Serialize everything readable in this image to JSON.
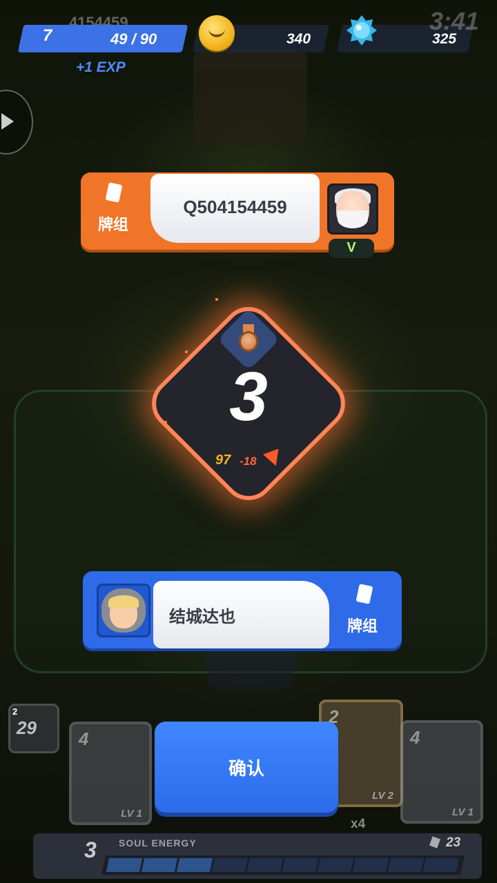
{
  "hud": {
    "ghost_name": "4154459",
    "level": "7",
    "xp": "49 / 90",
    "exp_gain": "+1 EXP",
    "coins": "340",
    "gems": "325",
    "clock": "3:41",
    "icons": {
      "coin": "coin-icon",
      "gem": "gem-icon",
      "play": "play-icon"
    }
  },
  "opponent": {
    "deck_label": "牌组",
    "name": "Q504154459",
    "badge": "V",
    "icons": {
      "deck": "deck-icon",
      "avatar": "old-wizard-avatar"
    }
  },
  "rank": {
    "number": "3",
    "score": "97",
    "delta": "-18",
    "icons": {
      "medal": "bronze-medal-icon",
      "trend": "down-arrow-icon"
    },
    "colors": {
      "border": "#ff8556",
      "score": "#f5b51c"
    }
  },
  "player": {
    "name": "结城达也",
    "deck_label": "牌组",
    "icons": {
      "deck": "deck-icon",
      "avatar": "hooded-girl-avatar"
    }
  },
  "cards": {
    "next_cost": "2",
    "next_value": "29",
    "hand": [
      {
        "cost": "4",
        "level": "LV 1"
      },
      {
        "cost": "2",
        "level": "LV 2"
      },
      {
        "cost": "4",
        "level": "LV 1"
      }
    ],
    "multiplier": "x4"
  },
  "confirm_label": "确认",
  "energy": {
    "count": "3",
    "label": "SOUL ENERGY",
    "deck_remaining": "23",
    "filled_segments": 3,
    "total_segments": 10
  },
  "colors": {
    "player": "#2f6ae8",
    "opponent": "#f07528",
    "accent": "#3d72e6"
  }
}
